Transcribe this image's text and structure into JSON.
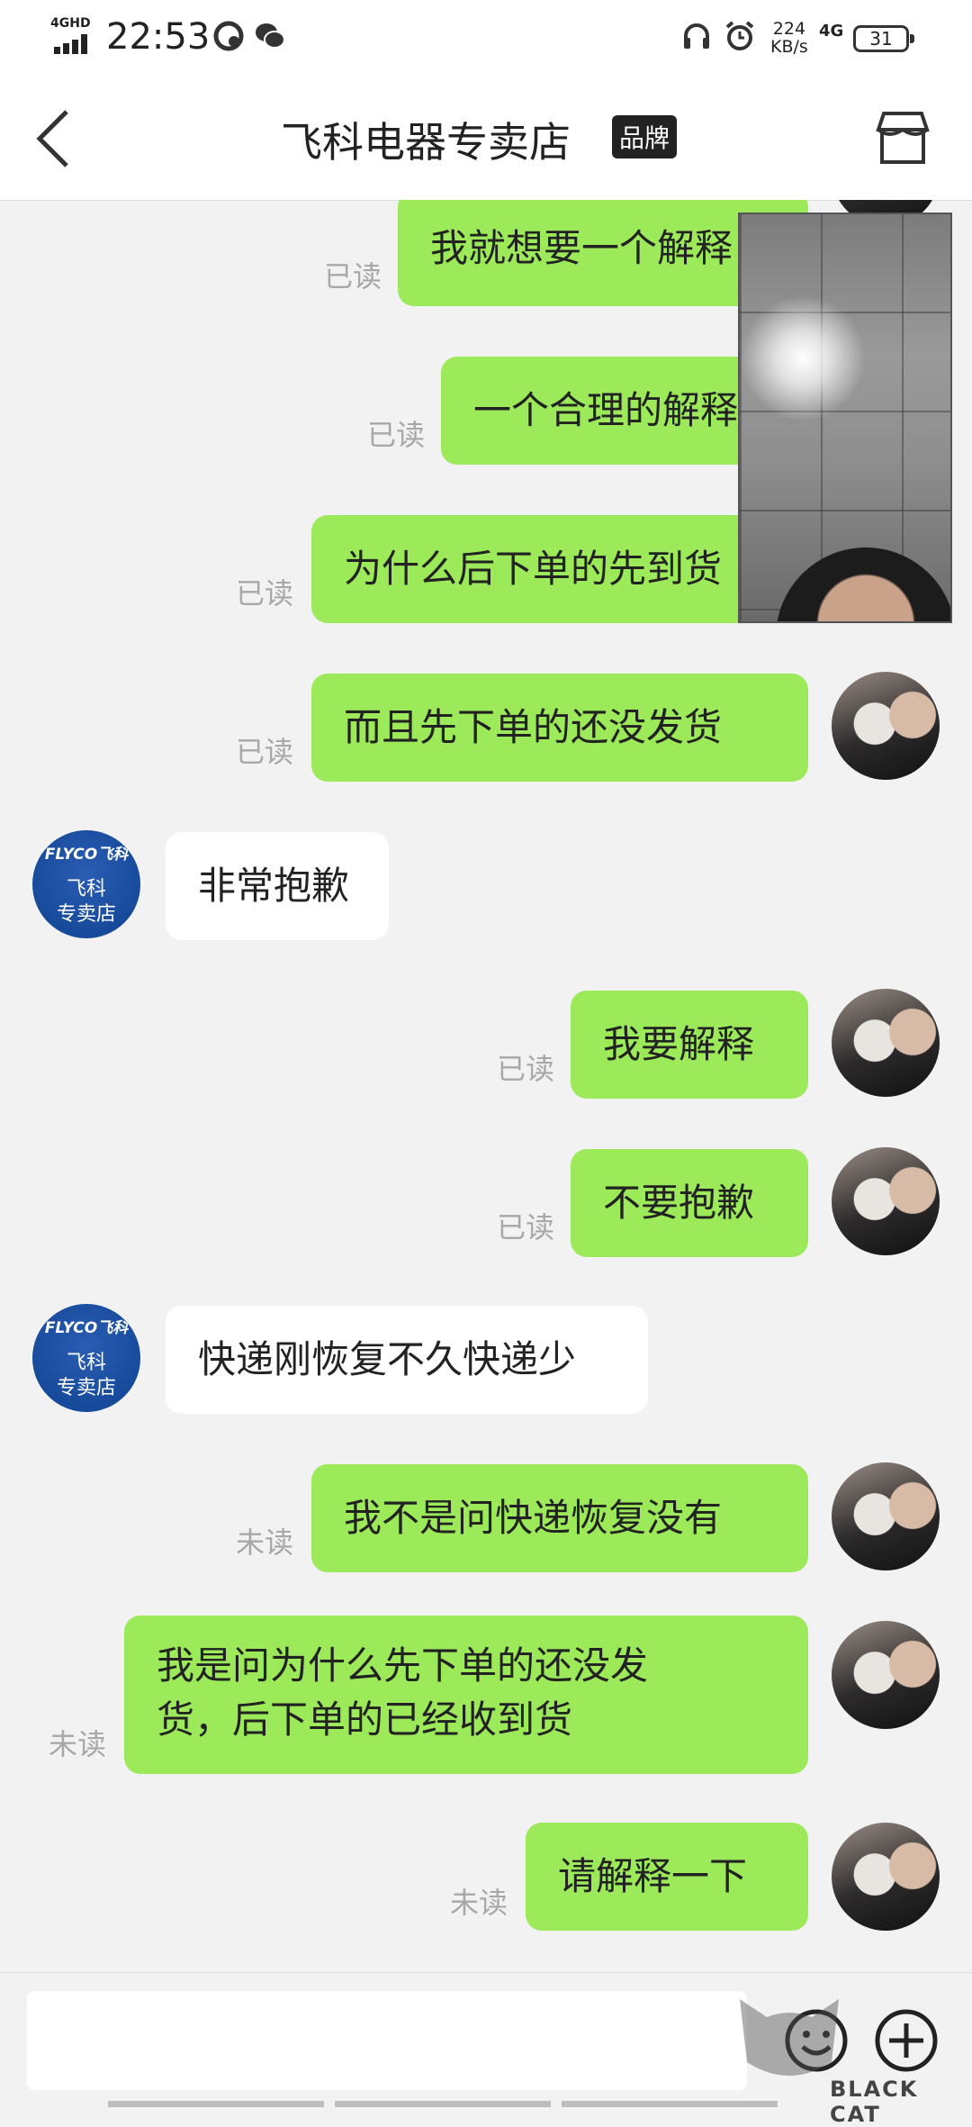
{
  "status_bar": {
    "network_badge": "4GHD",
    "time": "22:53",
    "speed_value": "224",
    "speed_unit": "KB/s",
    "net_type": "4G",
    "battery": "31"
  },
  "header": {
    "title": "飞科电器专卖店",
    "badge": "品牌"
  },
  "shop_avatar": {
    "logo": "FLYCO飞科",
    "line1": "飞科",
    "line2": "专卖店"
  },
  "messages": [
    {
      "side": "out",
      "text": "我就想要一个解释",
      "status": "已读"
    },
    {
      "side": "out",
      "text": "一个合理的解释",
      "status": "已读"
    },
    {
      "side": "out",
      "text": "为什么后下单的先到货",
      "status": "已读"
    },
    {
      "side": "out",
      "text": "而且先下单的还没发货",
      "status": "已读"
    },
    {
      "side": "in",
      "text": "非常抱歉"
    },
    {
      "side": "out",
      "text": "我要解释",
      "status": "已读"
    },
    {
      "side": "out",
      "text": "不要抱歉",
      "status": "已读"
    },
    {
      "side": "in",
      "text": "快递刚恢复不久快递少"
    },
    {
      "side": "out",
      "text": "我不是问快递恢复没有",
      "status": "未读"
    },
    {
      "side": "out",
      "text_line1": "我是问为什么先下单的还没发",
      "text_line2": "货，后下单的已经收到货",
      "status": "未读"
    },
    {
      "side": "out",
      "text": "请解释一下",
      "status": "未读"
    }
  ],
  "watermark": {
    "text": "BLACK CAT"
  },
  "colors": {
    "outgoing_bubble": "#9ce95a",
    "incoming_bubble": "#ffffff",
    "background": "#f2f2f2"
  }
}
